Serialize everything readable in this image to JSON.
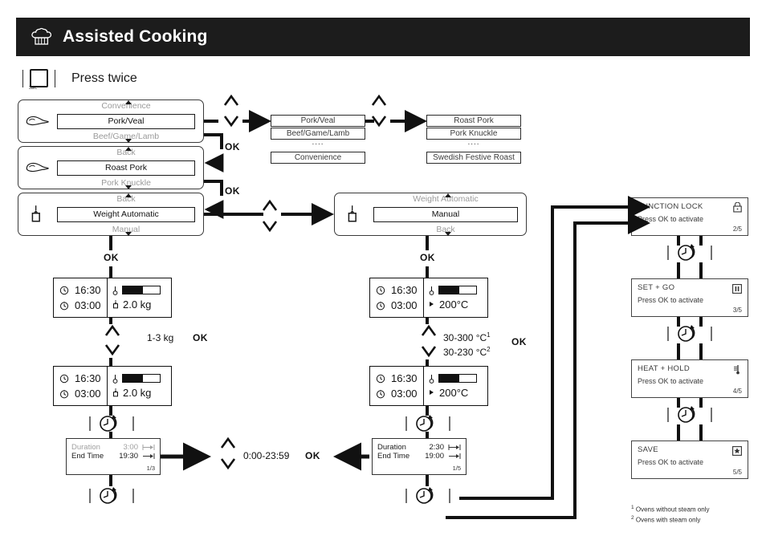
{
  "header": {
    "title": "Assisted Cooking",
    "icon": "chef-hat-icon"
  },
  "press_row": {
    "label": "Press twice",
    "button_icon": "square-button-icon",
    "button_sub": "3sec"
  },
  "menus": [
    {
      "id": "category",
      "icon": "roast-meat-icon",
      "above": "Convenience",
      "selected": "Pork/Veal",
      "below": "Beef/Game/Lamb"
    },
    {
      "id": "dish",
      "icon": "roast-meat-icon",
      "above": "Back",
      "selected": "Roast Pork",
      "below": "Pork Knuckle"
    },
    {
      "id": "mode-weight",
      "icon": "food-probe-icon",
      "above": "Back",
      "selected": "Weight Automatic",
      "below": "Manual"
    },
    {
      "id": "mode-manual",
      "icon": "food-probe-icon",
      "above": "Weight Automatic",
      "selected": "Manual",
      "below": "Back"
    }
  ],
  "lists": [
    {
      "id": "categories",
      "items": [
        "Pork/Veal",
        "Beef/Game/Lamb"
      ],
      "ellipsis": "....",
      "last": "Convenience"
    },
    {
      "id": "dishes",
      "items": [
        "Roast Pork",
        "Pork Knuckle"
      ],
      "ellipsis": "....",
      "last": "Swedish Festive Roast"
    }
  ],
  "displays": [
    {
      "id": "weight-1",
      "clock": "16:30",
      "timer": "03:00",
      "gauge_percent": 55,
      "value": "2.0 kg",
      "value_icon": "weight-icon"
    },
    {
      "id": "weight-2",
      "clock": "16:30",
      "timer": "03:00",
      "gauge_percent": 55,
      "value": "2.0 kg",
      "value_icon": "weight-icon"
    },
    {
      "id": "temp-1",
      "clock": "16:30",
      "timer": "03:00",
      "gauge_percent": 55,
      "value": "200°C",
      "value_icon": "fan-arrow-icon"
    },
    {
      "id": "temp-2",
      "clock": "16:30",
      "timer": "03:00",
      "gauge_percent": 55,
      "value": "200°C",
      "value_icon": "fan-arrow-icon"
    }
  ],
  "adjust": {
    "weight_range": "1-3 kg",
    "weight_ok": "OK",
    "temp_range_1": "30-300 °C",
    "temp_range_1_note": "1",
    "temp_range_2": "30-230 °C",
    "temp_range_2_note": "2",
    "temp_ok": "OK",
    "time_range": "0:00-23:59",
    "time_ok": "OK"
  },
  "ok_labels": {
    "a": "OK",
    "b": "OK",
    "c": "OK",
    "d": "OK",
    "e": "OK"
  },
  "duration_panels": [
    {
      "id": "left",
      "duration_label": "Duration",
      "duration_value": "3:00",
      "duration_icon": "duration-icon",
      "end_label": "End Time",
      "end_value": "19:30",
      "end_icon": "end-time-icon",
      "page": "1/3",
      "duration_muted": true
    },
    {
      "id": "right",
      "duration_label": "Duration",
      "duration_value": "2:30",
      "duration_icon": "duration-icon",
      "end_label": "End Time",
      "end_value": "19:00",
      "end_icon": "end-time-icon",
      "page": "1/5",
      "duration_muted": false
    }
  ],
  "functions": [
    {
      "title": "FUNCTION LOCK",
      "sub": "Press OK to activate",
      "page": "2/5",
      "icon": "lock-icon"
    },
    {
      "title": "SET + GO",
      "sub": "Press OK to activate",
      "page": "3/5",
      "icon": "pause-icon"
    },
    {
      "title": "HEAT + HOLD",
      "sub": "Press OK to activate",
      "page": "4/5",
      "icon": "thermometer-icon"
    },
    {
      "title": "SAVE",
      "sub": "Press OK to activate",
      "page": "5/5",
      "icon": "star-box-icon"
    }
  ],
  "footnotes": [
    "Ovens without steam only",
    "Ovens with steam only"
  ],
  "footnote_marks": [
    "1",
    "2"
  ],
  "colors": {
    "header_bg": "#1c1c1c",
    "header_text": "#ffffff",
    "line": "#111111",
    "muted": "#9a9a9a"
  }
}
